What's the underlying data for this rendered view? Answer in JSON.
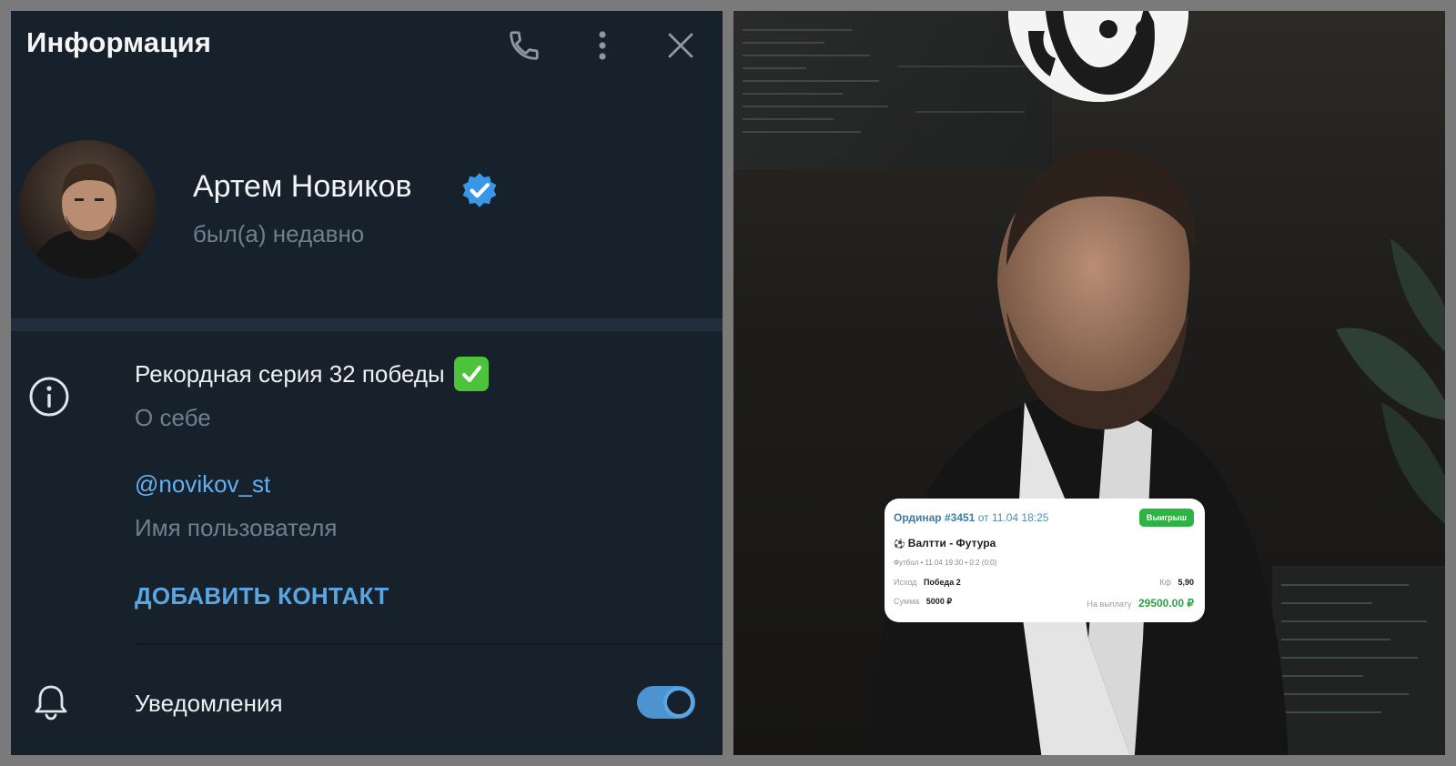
{
  "header": {
    "title": "Информация"
  },
  "profile": {
    "name": "Артем Новиков",
    "status": "был(а) недавно"
  },
  "info": {
    "bio": "Рекордная серия 32 победы",
    "bio_label": "О себе",
    "username": "@novikov_st",
    "username_label": "Имя пользователя",
    "add_contact": "ДОБАВИТЬ КОНТАКТ"
  },
  "notifications": {
    "label": "Уведомления",
    "enabled": true
  },
  "bet_card": {
    "type": "Ординар",
    "number": "#3451",
    "date_prefix": "от",
    "date": "11.04 18:25",
    "badge": "Выигрыш",
    "match": "Валтти - Футура",
    "meta": "Футбол • 11.04 19:30 • 0:2 (0:0)",
    "outcome_label": "Исход",
    "outcome": "Победа 2",
    "odds_label": "Кф",
    "odds": "5,90",
    "stake_label": "Сумма",
    "stake": "5000 ₽",
    "payout_label": "На выплату",
    "payout": "29500.00 ₽"
  },
  "colors": {
    "panel_bg": "#17212b",
    "accent": "#5aa6e3",
    "muted_text": "#6f7f8f",
    "win_green": "#2fb344"
  },
  "icons": {
    "call": "phone-icon",
    "more": "more-vertical-icon",
    "close": "close-icon",
    "info": "info-icon",
    "bell": "bell-icon",
    "verified": "verified-badge-icon",
    "check": "check-mark-emoji"
  }
}
